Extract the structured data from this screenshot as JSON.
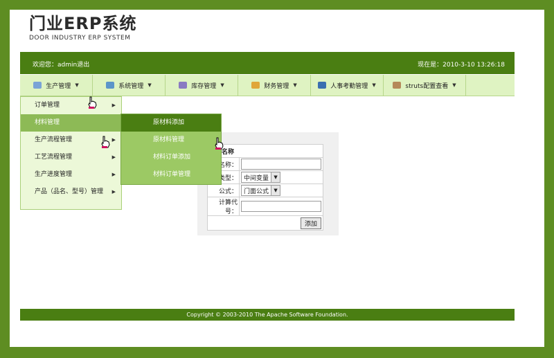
{
  "brand": {
    "title": "门业ERP系统",
    "subtitle": "DOOR INDUSTRY ERP SYSTEM"
  },
  "topbar": {
    "welcome": "欢迎您：admin",
    "logout": "退出",
    "clock": "现在是：2010-3-10 13:26:18"
  },
  "menu": [
    {
      "label": "生产管理",
      "icon": "production-icon"
    },
    {
      "label": "系统管理",
      "icon": "system-icon"
    },
    {
      "label": "库存管理",
      "icon": "inventory-icon"
    },
    {
      "label": "财务管理",
      "icon": "finance-icon"
    },
    {
      "label": "人事考勤管理",
      "icon": "hr-icon"
    },
    {
      "label": "struts配置查看",
      "icon": "config-icon"
    }
  ],
  "submenu": [
    {
      "label": "订单管理"
    },
    {
      "label": "材料管理"
    },
    {
      "label": "生产流程管理"
    },
    {
      "label": "工艺流程管理"
    },
    {
      "label": "生产进度管理"
    },
    {
      "label": "产品（品名、型号）管理"
    }
  ],
  "submenu2": [
    {
      "label": "原材料添加"
    },
    {
      "label": "原材料管理"
    },
    {
      "label": "材料订单添加"
    },
    {
      "label": "材料订单管理"
    }
  ],
  "form": {
    "header": "计算名称",
    "name_label": "名称：",
    "type_label": "类型：",
    "type_value": "中间变量",
    "formula_label": "公式：",
    "formula_value": "门面公式",
    "code_label": "计算代号：",
    "add_button": "添加"
  },
  "footer": {
    "copyright": "Copyright © 2003-2010 The Apache Software Foundation."
  },
  "colors": {
    "outer": "#5e8d22",
    "bar": "#4a7e12",
    "menu_bg": "#dff3c2",
    "submenu_active": "#8dba56",
    "submenu2_bg": "#9cc964"
  }
}
